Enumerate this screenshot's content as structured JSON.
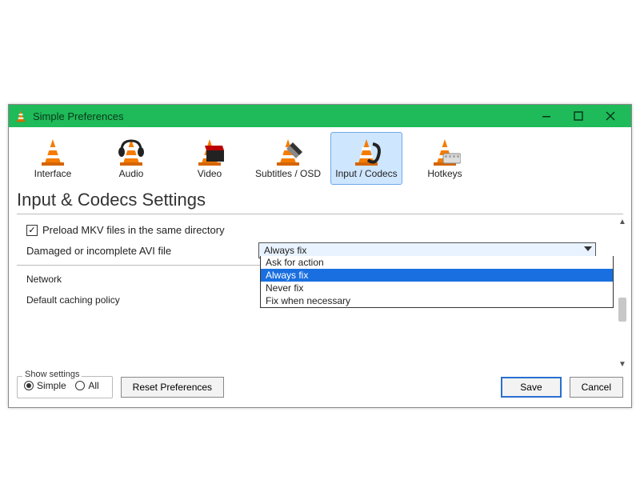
{
  "window": {
    "title": "Simple Preferences"
  },
  "tabs": [
    {
      "label": "Interface"
    },
    {
      "label": "Audio"
    },
    {
      "label": "Video"
    },
    {
      "label": "Subtitles / OSD"
    },
    {
      "label": "Input / Codecs"
    },
    {
      "label": "Hotkeys"
    }
  ],
  "heading": "Input & Codecs Settings",
  "preload_checkbox": {
    "label": "Preload MKV files in the same directory",
    "checked": true
  },
  "avi": {
    "label": "Damaged or incomplete AVI file",
    "selected": "Always fix",
    "options": [
      "Ask for action",
      "Always fix",
      "Never fix",
      "Fix when necessary"
    ]
  },
  "network_label": "Network",
  "caching_label": "Default caching policy",
  "show_settings": {
    "legend": "Show settings",
    "simple": "Simple",
    "all": "All",
    "value": "Simple"
  },
  "buttons": {
    "reset": "Reset Preferences",
    "save": "Save",
    "cancel": "Cancel"
  }
}
